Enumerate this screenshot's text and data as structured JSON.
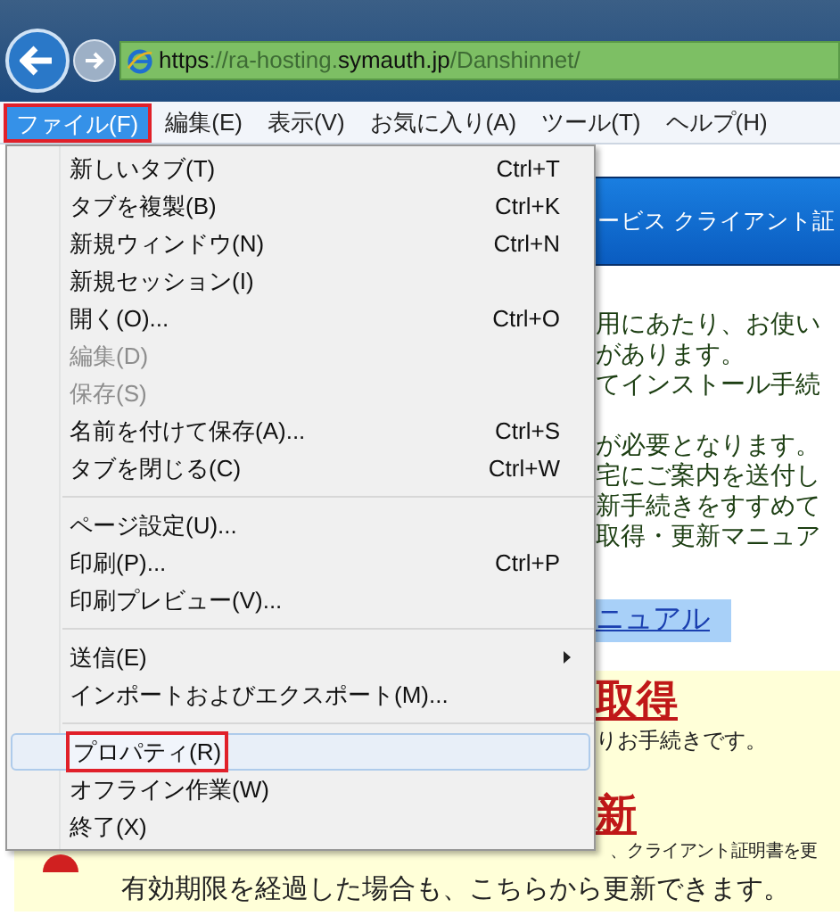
{
  "address_bar": {
    "url_parts": [
      {
        "text": "https",
        "emphasis": true
      },
      {
        "text": "://ra-hosting.",
        "emphasis": false
      },
      {
        "text": "symauth.jp",
        "emphasis": true
      },
      {
        "text": "/Danshinnet/",
        "emphasis": false
      }
    ]
  },
  "menu_bar": [
    {
      "label": "ファイル(F)",
      "selected": true
    },
    {
      "label": "編集(E)",
      "selected": false
    },
    {
      "label": "表示(V)",
      "selected": false
    },
    {
      "label": "お気に入り(A)",
      "selected": false
    },
    {
      "label": "ツール(T)",
      "selected": false
    },
    {
      "label": "ヘルプ(H)",
      "selected": false
    }
  ],
  "file_menu": [
    {
      "kind": "item",
      "label": "新しいタブ(T)",
      "shortcut": "Ctrl+T",
      "disabled": false,
      "selected": false
    },
    {
      "kind": "item",
      "label": "タブを複製(B)",
      "shortcut": "Ctrl+K",
      "disabled": false,
      "selected": false
    },
    {
      "kind": "item",
      "label": "新規ウィンドウ(N)",
      "shortcut": "Ctrl+N",
      "disabled": false,
      "selected": false
    },
    {
      "kind": "item",
      "label": "新規セッション(I)",
      "disabled": false,
      "selected": false
    },
    {
      "kind": "item",
      "label": "開く(O)...",
      "shortcut": "Ctrl+O",
      "disabled": false,
      "selected": false
    },
    {
      "kind": "item",
      "label": "編集(D)",
      "disabled": true,
      "selected": false
    },
    {
      "kind": "item",
      "label": "保存(S)",
      "disabled": true,
      "selected": false
    },
    {
      "kind": "item",
      "label": "名前を付けて保存(A)...",
      "shortcut": "Ctrl+S",
      "disabled": false,
      "selected": false
    },
    {
      "kind": "item",
      "label": "タブを閉じる(C)",
      "shortcut": "Ctrl+W",
      "disabled": false,
      "selected": false
    },
    {
      "kind": "separator"
    },
    {
      "kind": "item",
      "label": "ページ設定(U)...",
      "disabled": false,
      "selected": false
    },
    {
      "kind": "item",
      "label": "印刷(P)...",
      "shortcut": "Ctrl+P",
      "disabled": false,
      "selected": false
    },
    {
      "kind": "item",
      "label": "印刷プレビュー(V)...",
      "disabled": false,
      "selected": false
    },
    {
      "kind": "separator"
    },
    {
      "kind": "submenu",
      "label": "送信(E)",
      "disabled": false,
      "selected": false
    },
    {
      "kind": "item",
      "label": "インポートおよびエクスポート(M)...",
      "disabled": false,
      "selected": false
    },
    {
      "kind": "separator"
    },
    {
      "kind": "item",
      "label": "プロパティ(R)",
      "disabled": false,
      "selected": true
    },
    {
      "kind": "item",
      "label": "オフライン作業(W)",
      "disabled": false,
      "selected": false
    },
    {
      "kind": "item",
      "label": "終了(X)",
      "disabled": false,
      "selected": false
    }
  ],
  "page": {
    "banner": "ービス クライアント証",
    "paragraph_1": [
      "用にあたり、お使い",
      "があります。",
      "てインストール手続"
    ],
    "paragraph_2": [
      "が必要となります。",
      "宅にご案内を送付し",
      "新手続きをすすめて",
      "取得・更新マニュア"
    ],
    "manual_link": "ニュアル",
    "section_1": {
      "heading": "取得",
      "text": "りお手続きです。"
    },
    "section_2": {
      "heading": "新",
      "lines": [
        "、クライアント証明書を更",
        "有効期限を経過した場合も、こちらから更新できます。"
      ]
    }
  }
}
